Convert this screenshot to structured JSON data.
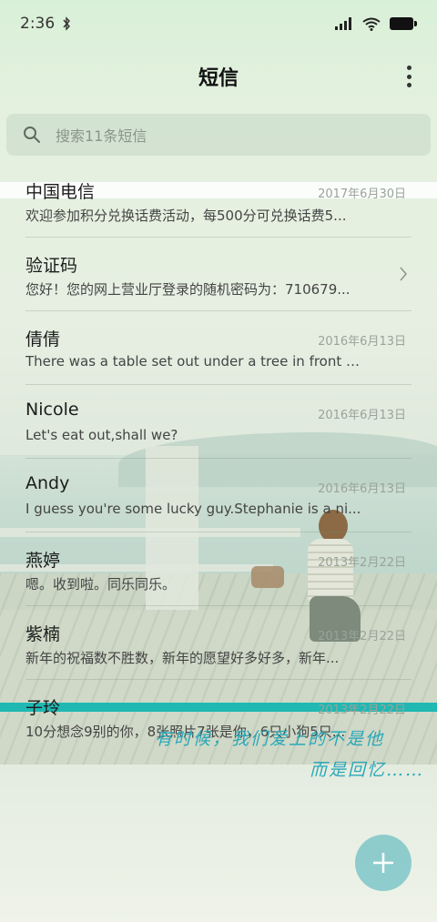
{
  "status_bar": {
    "time": "2:36",
    "icons": [
      "bluetooth-icon",
      "signal-icon",
      "wifi-icon",
      "battery-icon"
    ]
  },
  "header": {
    "title": "短信",
    "menu_icon": "more-vert-icon"
  },
  "search": {
    "placeholder": "搜索11条短信",
    "icon": "search-icon"
  },
  "messages": [
    {
      "sender": "中国电信",
      "date": "2017年6月30日",
      "preview": "欢迎参加积分兑换话费活动，每500分可兑换话费5..."
    },
    {
      "sender": "验证码",
      "date": "",
      "preview": "您好！您的网上营业厅登录的随机密码为：710679..."
    },
    {
      "sender": "倩倩",
      "date": "2016年6月13日",
      "preview": "There was a table set out under a tree in front of ..."
    },
    {
      "sender": "Nicole",
      "date": "2016年6月13日",
      "preview": "Let's eat out,shall we?"
    },
    {
      "sender": "Andy",
      "date": "2016年6月13日",
      "preview": "I guess you're some lucky guy.Stephanie is a ni..."
    },
    {
      "sender": "燕婷",
      "date": "2013年2月22日",
      "preview": "嗯。收到啦。同乐同乐。"
    },
    {
      "sender": "紫楠",
      "date": "2013年2月22日",
      "preview": "新年的祝福数不胜数，新年的愿望好多好多，新年..."
    },
    {
      "sender": "子玲",
      "date": "2013年2月22日",
      "preview": "10分想念9别的你，8张照片7张是你，6只小狗5只..."
    }
  ],
  "wallpaper_text": {
    "line1": "有时候，我们爱上的不是他",
    "line2": "而是回忆……"
  },
  "fab": {
    "icon": "plus-icon"
  },
  "colors": {
    "accent": "#1fb8b2",
    "fab": "#7ec6c8"
  }
}
